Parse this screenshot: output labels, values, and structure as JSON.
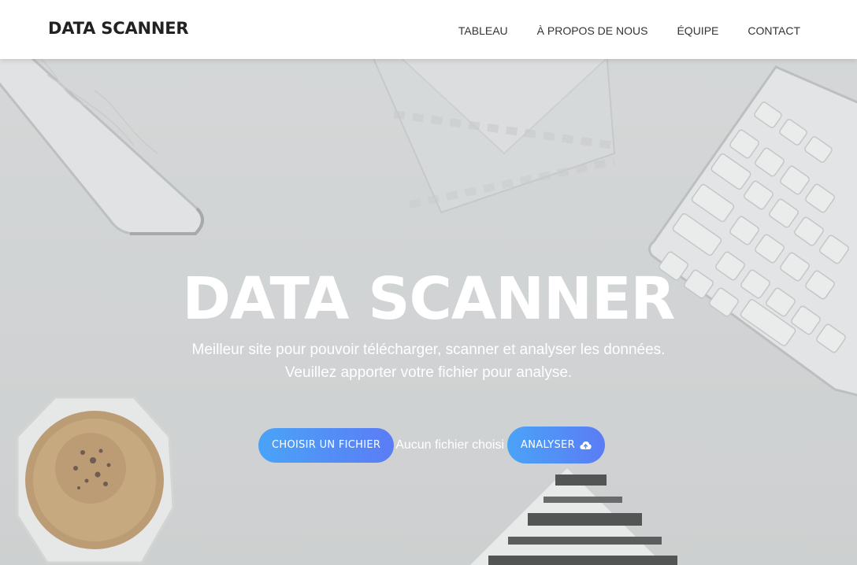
{
  "nav": {
    "brand": "DATA SCANNER",
    "links": [
      "TABLEAU",
      "À PROPOS DE NOUS",
      "ÉQUIPE",
      "CONTACT"
    ]
  },
  "hero": {
    "title": "DATA SCANNER",
    "subtitle": "Meilleur site pour pouvoir télécharger, scanner et analyser les données. Veuillez apporter votre fichier pour analyse.",
    "choose_file_label": "CHOISIR UN FICHIER",
    "no_file_text": "Aucun fichier choisi",
    "analyze_label": "ANALYSER",
    "analyze_icon": "cloud-upload-icon"
  },
  "colors": {
    "accent_start": "#4aa3f7",
    "accent_end": "#5b7cf5",
    "navbar_bg": "#ffffff",
    "hero_text": "#ffffff"
  }
}
